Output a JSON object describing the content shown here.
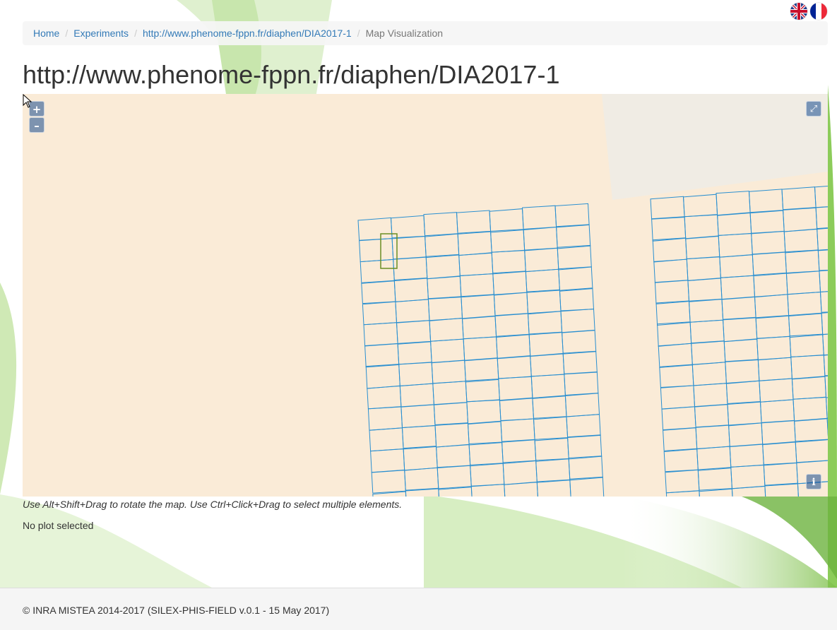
{
  "languages": [
    {
      "name": "english-flag-icon"
    },
    {
      "name": "french-flag-icon"
    }
  ],
  "breadcrumb": {
    "home": "Home",
    "experiments": "Experiments",
    "experiment": "http://www.phenome-fppn.fr/diaphen/DIA2017-1",
    "current": "Map Visualization"
  },
  "page_title": "http://www.phenome-fppn.fr/diaphen/DIA2017-1",
  "map": {
    "zoom_in": "+",
    "zoom_out": "–",
    "fullscreen_icon": "expand-icon",
    "attribution": "i",
    "fill_color": "#faebd7",
    "plot_stroke_color": "#2a8fd0",
    "selected_plot_color": "#6b8e23"
  },
  "hint": "Use Alt+Shift+Drag to rotate the map. Use Ctrl+Click+Drag to select multiple elements.",
  "selection_status": "No plot selected",
  "footer": "© INRA MISTEA 2014-2017 (SILEX-PHIS-FIELD v.0.1 - 15 May 2017)"
}
